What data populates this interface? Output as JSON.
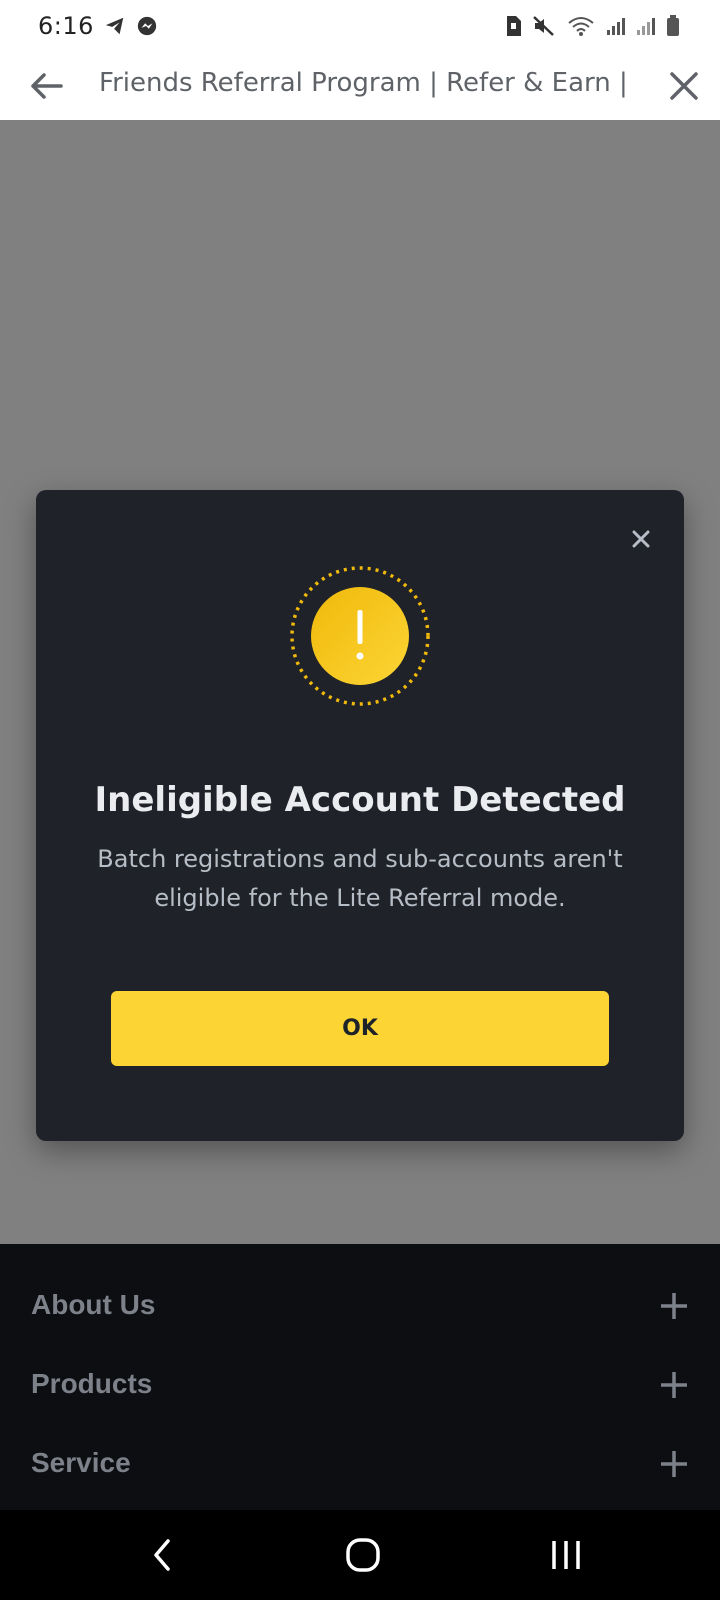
{
  "status_bar": {
    "time": "6:16",
    "left_icons": [
      "telegram-icon",
      "messenger-icon"
    ],
    "right_icons": [
      "sim-alert-icon",
      "mute-icon",
      "wifi-icon",
      "signal-icon",
      "signal-icon",
      "battery-icon"
    ]
  },
  "app_bar": {
    "title": "Friends Referral Program | Refer & Earn |...",
    "back_icon": "arrow-left-icon",
    "close_icon": "close-icon"
  },
  "modal": {
    "icon": "warning-icon",
    "title": "Ineligible Account Detected",
    "description": "Batch registrations and sub-accounts aren't eligible for the Lite Referral mode.",
    "ok_label": "OK",
    "accent_color": "#fcd535",
    "background_color": "#1f2229"
  },
  "footer": {
    "items": [
      {
        "label": "About Us"
      },
      {
        "label": "Products"
      },
      {
        "label": "Service"
      }
    ]
  },
  "nav_bar": {
    "buttons": [
      "back-nav-icon",
      "home-nav-icon",
      "recents-nav-icon"
    ]
  }
}
